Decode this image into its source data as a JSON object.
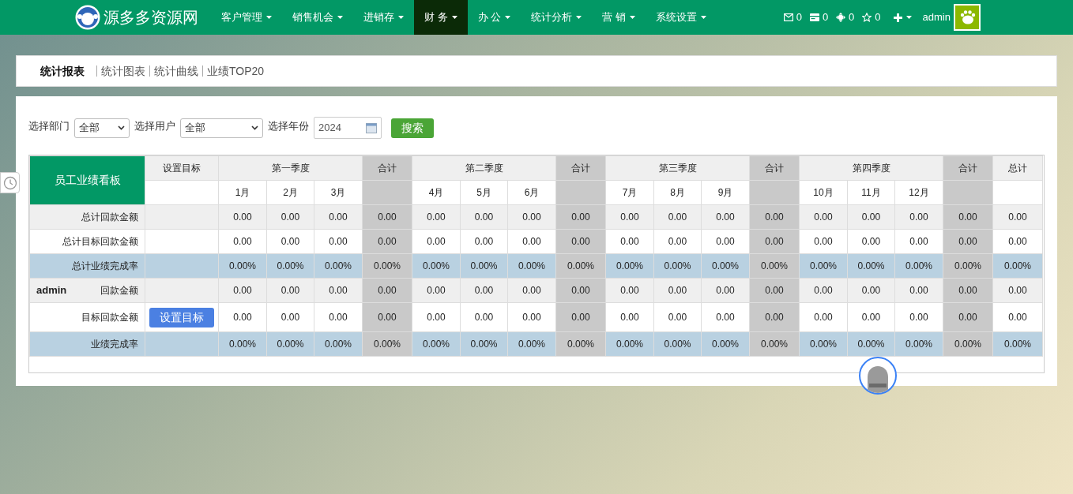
{
  "nav": {
    "brand": "源多多资源网",
    "menu": [
      {
        "label": "客户管理",
        "selected": false
      },
      {
        "label": "销售机会",
        "selected": false
      },
      {
        "label": "进销存",
        "selected": false
      },
      {
        "label": "财 务",
        "selected": true
      },
      {
        "label": "办 公",
        "selected": false
      },
      {
        "label": "统计分析",
        "selected": false
      },
      {
        "label": "营 销",
        "selected": false
      },
      {
        "label": "系统设置",
        "selected": false
      }
    ],
    "counters": [
      {
        "kind": "mail",
        "count": "0"
      },
      {
        "kind": "card",
        "count": "0"
      },
      {
        "kind": "move",
        "count": "0"
      },
      {
        "kind": "star",
        "count": "0"
      }
    ],
    "user": "admin"
  },
  "tabs": [
    {
      "label": "统计报表",
      "selected": true
    },
    {
      "label": "统计图表",
      "selected": false
    },
    {
      "label": "统计曲线",
      "selected": false
    },
    {
      "label": "业绩TOP20",
      "selected": false
    }
  ],
  "filters": {
    "department": {
      "label": "选择部门",
      "value": "全部"
    },
    "user": {
      "label": "选择用户",
      "value": "全部"
    },
    "year": {
      "label": "选择年份",
      "value": "2024"
    },
    "search": "搜索"
  },
  "table": {
    "title": "员工业绩看板",
    "target_header": "设置目标",
    "quarters": [
      {
        "label": "第一季度",
        "months": [
          "1月",
          "2月",
          "3月"
        ],
        "subtotal": "合计"
      },
      {
        "label": "第二季度",
        "months": [
          "4月",
          "5月",
          "6月"
        ],
        "subtotal": "合计"
      },
      {
        "label": "第三季度",
        "months": [
          "7月",
          "8月",
          "9月"
        ],
        "subtotal": "合计"
      },
      {
        "label": "第四季度",
        "months": [
          "10月",
          "11月",
          "12月"
        ],
        "subtotal": "合计"
      }
    ],
    "total": "总计",
    "rows": [
      {
        "kind": "amount",
        "label": "总计回款金额",
        "values": [
          "0.00",
          "0.00",
          "0.00",
          "0.00",
          "0.00",
          "0.00",
          "0.00",
          "0.00",
          "0.00",
          "0.00",
          "0.00",
          "0.00",
          "0.00",
          "0.00",
          "0.00",
          "0.00",
          "0.00"
        ]
      },
      {
        "kind": "target",
        "label": "总计目标回款金额",
        "values": [
          "0.00",
          "0.00",
          "0.00",
          "0.00",
          "0.00",
          "0.00",
          "0.00",
          "0.00",
          "0.00",
          "0.00",
          "0.00",
          "0.00",
          "0.00",
          "0.00",
          "0.00",
          "0.00",
          "0.00"
        ]
      },
      {
        "kind": "rate",
        "label": "总计业绩完成率",
        "values": [
          "0.00%",
          "0.00%",
          "0.00%",
          "0.00%",
          "0.00%",
          "0.00%",
          "0.00%",
          "0.00%",
          "0.00%",
          "0.00%",
          "0.00%",
          "0.00%",
          "0.00%",
          "0.00%",
          "0.00%",
          "0.00%",
          "0.00%"
        ]
      },
      {
        "kind": "amount",
        "user": "admin",
        "label": "回款金额",
        "values": [
          "0.00",
          "0.00",
          "0.00",
          "0.00",
          "0.00",
          "0.00",
          "0.00",
          "0.00",
          "0.00",
          "0.00",
          "0.00",
          "0.00",
          "0.00",
          "0.00",
          "0.00",
          "0.00",
          "0.00"
        ]
      },
      {
        "kind": "target",
        "label": "目标回款金额",
        "button": "设置目标",
        "values": [
          "0.00",
          "0.00",
          "0.00",
          "0.00",
          "0.00",
          "0.00",
          "0.00",
          "0.00",
          "0.00",
          "0.00",
          "0.00",
          "0.00",
          "0.00",
          "0.00",
          "0.00",
          "0.00",
          "0.00"
        ]
      },
      {
        "kind": "rate",
        "label": "业绩完成率",
        "values": [
          "0.00%",
          "0.00%",
          "0.00%",
          "0.00%",
          "0.00%",
          "0.00%",
          "0.00%",
          "0.00%",
          "0.00%",
          "0.00%",
          "0.00%",
          "0.00%",
          "0.00%",
          "0.00%",
          "0.00%",
          "0.00%",
          "0.00%"
        ]
      }
    ]
  }
}
